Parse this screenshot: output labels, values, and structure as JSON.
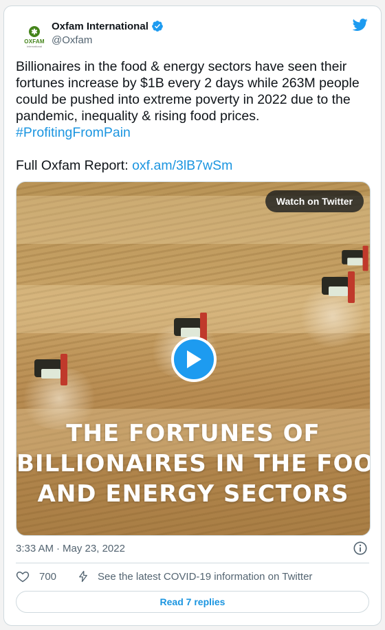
{
  "author": {
    "display_name": "Oxfam International",
    "handle": "@Oxfam",
    "avatar_text": "OXFAM",
    "avatar_subtext": "International",
    "verified": true
  },
  "tweet": {
    "text": "Billionaires in the food & energy sectors have seen their fortunes increase by $1B every 2 days while 263M people could be pushed into extreme poverty in 2022 due to the pandemic, inequality & rising food prices.",
    "hashtag": "#ProfitingFromPain",
    "report_label": "Full Oxfam Report:",
    "report_link": "oxf.am/3lB7wSm"
  },
  "media": {
    "watch_label": "Watch on Twitter",
    "title_lines": [
      "THE FORTUNES OF",
      "BILLIONAIRES IN THE FOOD",
      "AND ENERGY SECTORS"
    ]
  },
  "meta": {
    "time": "3:33 AM",
    "separator": "·",
    "date": "May 23, 2022"
  },
  "actions": {
    "like_count": "700",
    "covid_label": "See the latest COVID-19 information on Twitter",
    "read_replies_label": "Read 7 replies"
  },
  "colors": {
    "link": "#1b95e0",
    "play_button": "#1d9bf0",
    "oxfam_green": "#44841a"
  }
}
